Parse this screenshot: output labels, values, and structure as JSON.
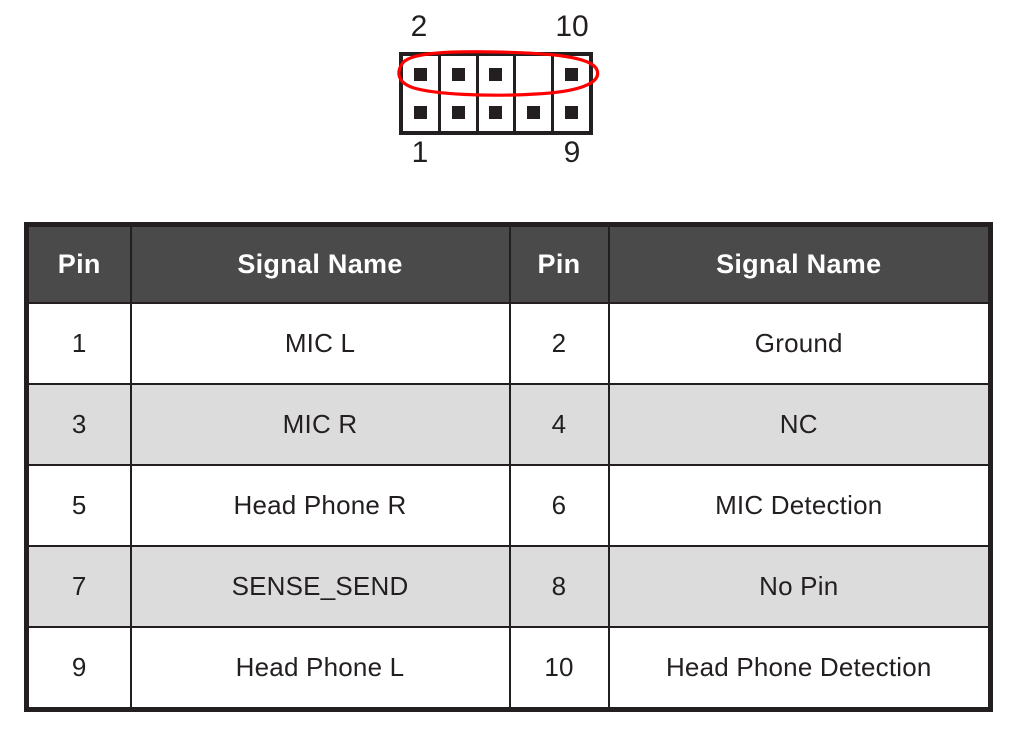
{
  "diagram": {
    "name": "front-panel-audio-connector",
    "labels": {
      "top_left": "2",
      "top_right": "10",
      "bottom_left": "1",
      "bottom_right": "9"
    },
    "columns": 5,
    "rows": 2,
    "top_row_pins": [
      true,
      true,
      true,
      false,
      true
    ],
    "bottom_row_pins": [
      true,
      true,
      true,
      true,
      true
    ],
    "annotation": {
      "shape": "ellipse",
      "color": "#ff0000",
      "target": "top-pin-row"
    }
  },
  "colors": {
    "header_bg": "#4a4a4a",
    "header_text": "#ffffff",
    "band_bg": "#dcdcdc",
    "row_bg": "#ffffff",
    "border": "#231f20",
    "annotation": "#ff0000",
    "pin_square": "#231f20"
  },
  "table": {
    "headers": [
      "Pin",
      "Signal Name",
      "Pin",
      "Signal Name"
    ],
    "rows": [
      {
        "banded": false,
        "cells": [
          "1",
          "MIC L",
          "2",
          "Ground"
        ]
      },
      {
        "banded": true,
        "cells": [
          "3",
          "MIC R",
          "4",
          "NC"
        ]
      },
      {
        "banded": false,
        "cells": [
          "5",
          "Head Phone R",
          "6",
          "MIC Detection"
        ]
      },
      {
        "banded": true,
        "cells": [
          "7",
          "SENSE_SEND",
          "8",
          "No Pin"
        ]
      },
      {
        "banded": false,
        "cells": [
          "9",
          "Head Phone L",
          "10",
          "Head Phone Detection"
        ]
      }
    ]
  }
}
